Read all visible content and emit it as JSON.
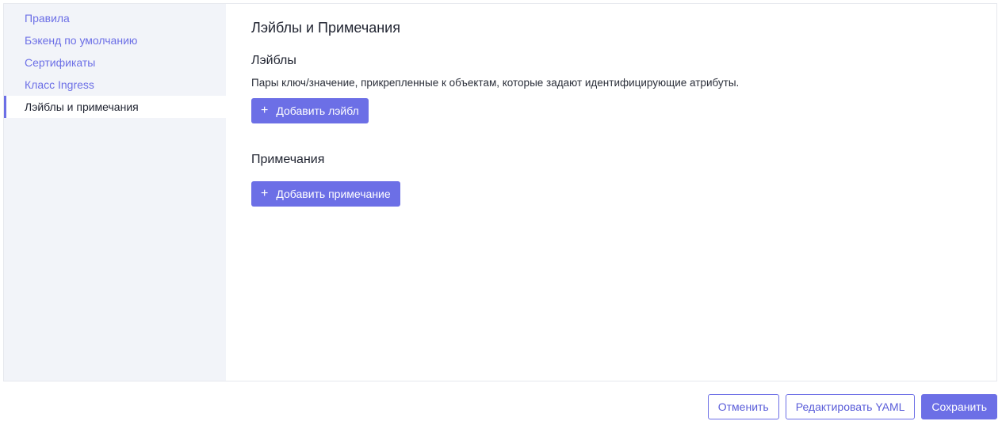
{
  "sidebar": {
    "items": [
      {
        "label": "Правила"
      },
      {
        "label": "Бэкенд по умолчанию"
      },
      {
        "label": "Сертификаты"
      },
      {
        "label": "Класс Ingress"
      },
      {
        "label": "Лэйблы и примечания",
        "active": true
      }
    ]
  },
  "main": {
    "title": "Лэйблы и Примечания",
    "labels_section": {
      "title": "Лэйблы",
      "description": "Пары ключ/значение, прикрепленные к объектам, которые задают идентифицирующие атрибуты.",
      "add_button": "Добавить лэйбл"
    },
    "annotations_section": {
      "title": "Примечания",
      "add_button": "Добавить примечание"
    }
  },
  "footer": {
    "cancel": "Отменить",
    "edit_yaml": "Редактировать YAML",
    "save": "Сохранить"
  },
  "colors": {
    "accent": "#6c6fe6",
    "sidebar_bg": "#f2f4f9"
  },
  "icons": {
    "add": "plus-icon"
  }
}
